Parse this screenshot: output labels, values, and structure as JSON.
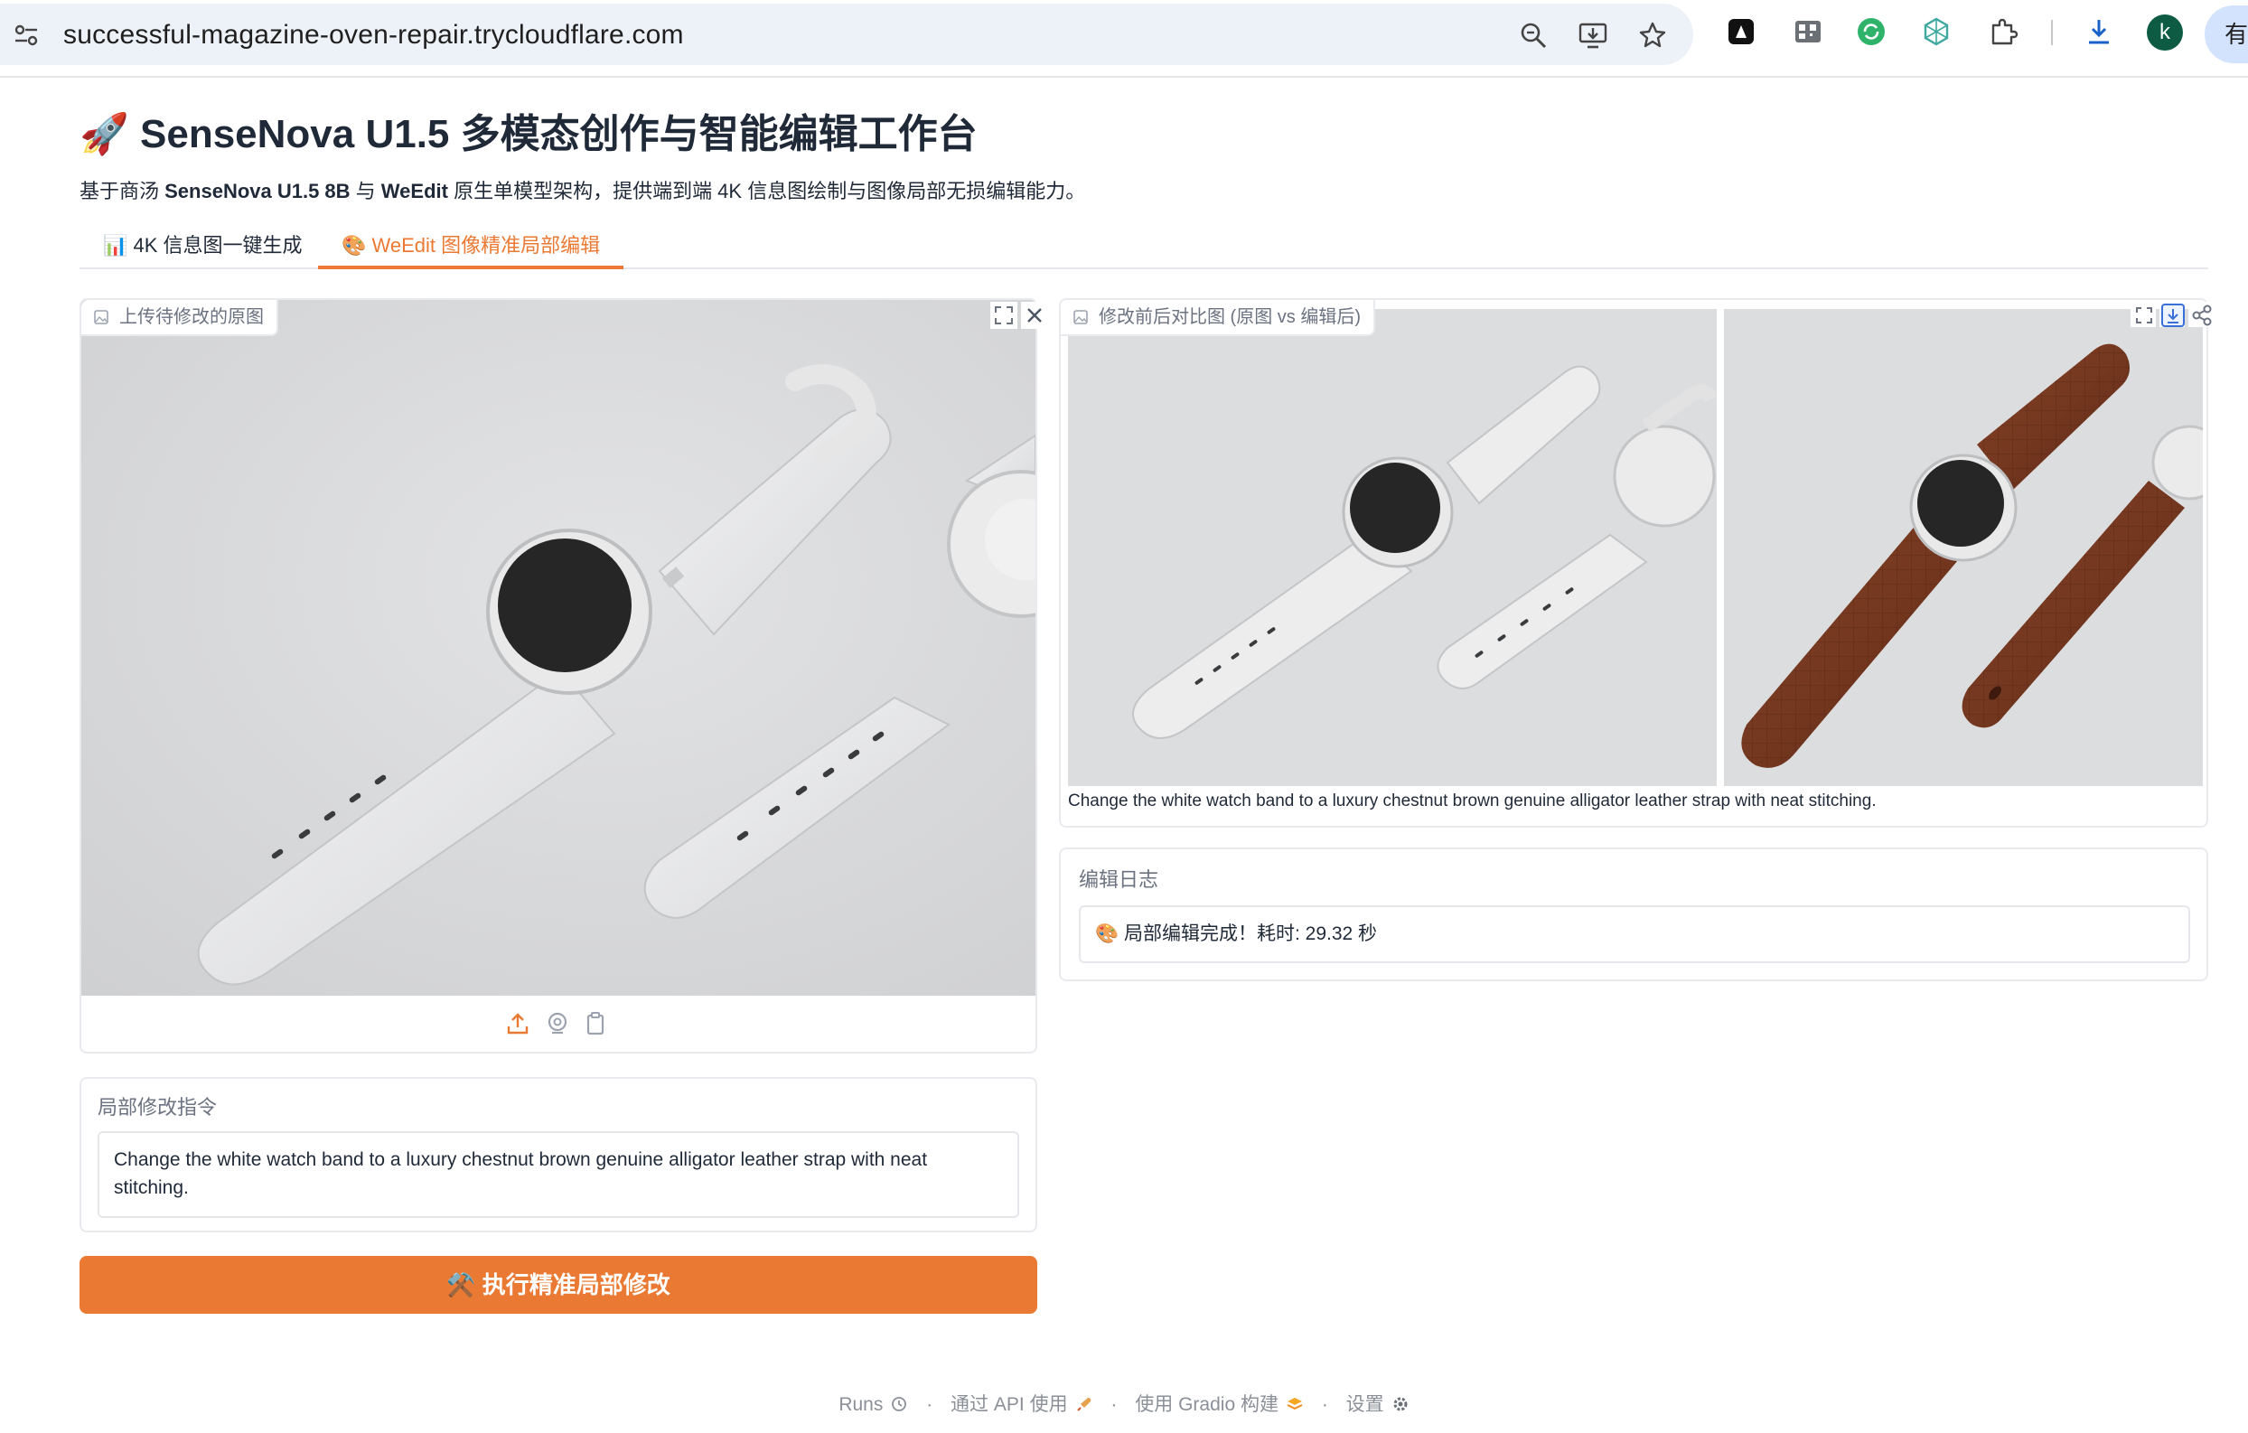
{
  "browser": {
    "url": "successful-magazine-oven-repair.trycloudflare.com",
    "profile_initial": "k",
    "side_panel_label": "有"
  },
  "header": {
    "title": "🚀 SenseNova U1.5 多模态创作与智能编辑工作台",
    "desc_prefix": "基于商汤 ",
    "desc_model": "SenseNova U1.5 8B",
    "desc_mid": " 与 ",
    "desc_weedit": "WeEdit",
    "desc_suffix": " 原生单模型架构，提供端到端 4K 信息图绘制与图像局部无损编辑能力。"
  },
  "tabs": [
    {
      "label": "📊 4K 信息图一键生成",
      "active": false
    },
    {
      "label": "🎨 WeEdit 图像精准局部编辑",
      "active": true
    }
  ],
  "uploader": {
    "label": "上传待修改的原图",
    "tools": [
      "upload-icon",
      "webcam-icon",
      "clipboard-icon"
    ]
  },
  "prompt": {
    "label": "局部修改指令",
    "value": "Change the white watch band to a luxury chestnut brown genuine alligator leather strap with neat stitching."
  },
  "run_button": "⚒️ 执行精准局部修改",
  "compare": {
    "label": "修改前后对比图 (原图 vs 编辑后)",
    "caption": "Change the white watch band to a luxury chestnut brown genuine alligator leather strap with neat stitching."
  },
  "log": {
    "label": "编辑日志",
    "value": "🎨 局部编辑完成！耗时: 29.32 秒"
  },
  "footer": {
    "runs": "Runs",
    "api": "通过 API 使用",
    "built": "使用 Gradio 构建",
    "settings": "设置",
    "separator": "·"
  },
  "colors": {
    "accent": "#ea7a33",
    "image_bg": "#d9dadc",
    "leather": "#7a3a22"
  }
}
